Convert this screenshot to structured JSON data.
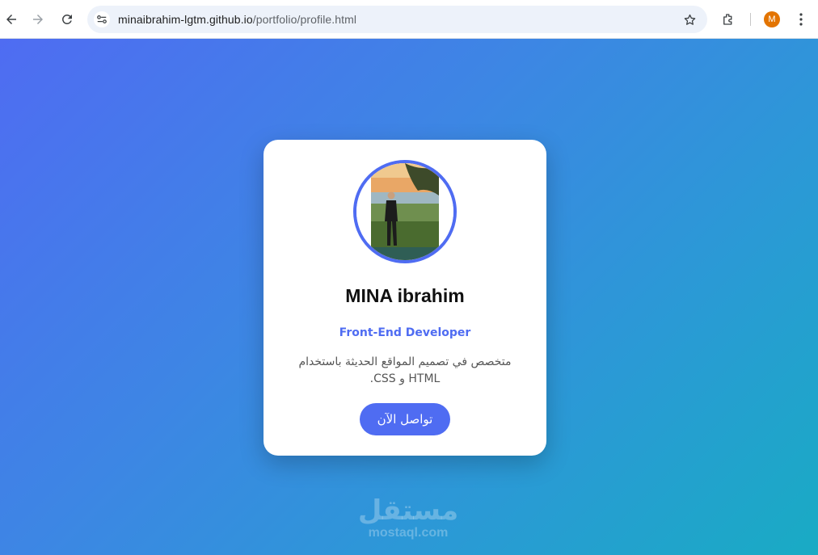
{
  "browser": {
    "url_host": "minaibrahim-lgtm.github.io",
    "url_path": "/portfolio/profile.html",
    "profile_initial": "M",
    "icons": [
      "back-arrow-icon",
      "forward-arrow-icon",
      "reload-icon",
      "site-settings-icon",
      "star-icon",
      "extensions-icon",
      "more-menu-icon"
    ]
  },
  "profile": {
    "name": "MINA ibrahim",
    "role": "Front-End Developer",
    "bio": "متخصص في تصميم المواقع الحديثة باستخدام HTML و CSS.",
    "cta_label": "تواصل الآن"
  },
  "watermark": {
    "arabic": "مستقل",
    "latin": "mostaql.com"
  },
  "colors": {
    "accent": "#4f6cf2",
    "gradient_start": "#4f6cf2",
    "gradient_end": "#19abc4",
    "card": "#ffffff"
  }
}
